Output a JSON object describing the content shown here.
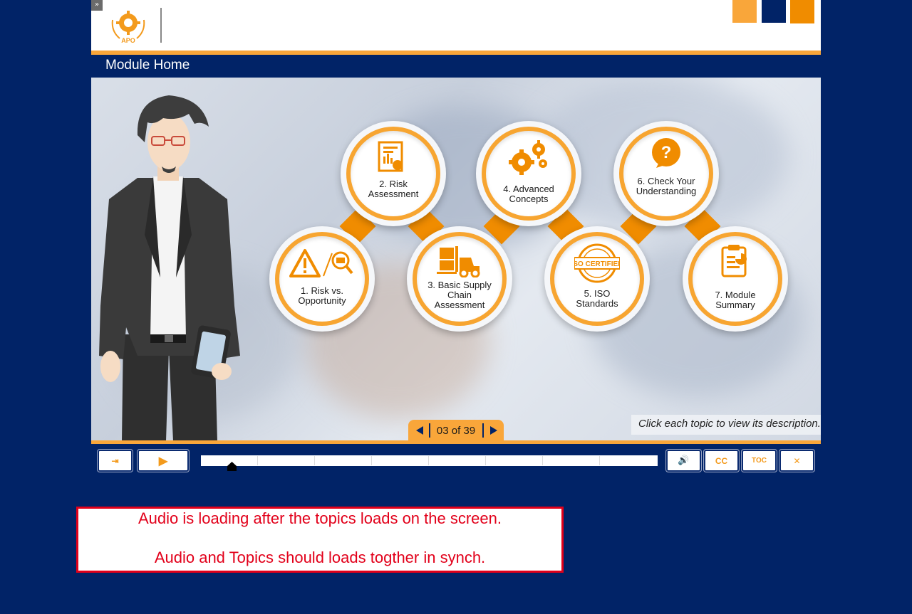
{
  "header": {
    "logo_text": "APO",
    "collapse_glyph": "»",
    "squares": [
      {
        "color": "#f9a63a"
      },
      {
        "color": "#012367"
      },
      {
        "color": "#f08c00"
      }
    ]
  },
  "page": {
    "title": "Module Home"
  },
  "topics": [
    {
      "label_line1": "1. Risk vs.",
      "label_line2": "Opportunity",
      "label_line3": "",
      "icon": "warning-magnifier-icon"
    },
    {
      "label_line1": "2. Risk",
      "label_line2": "Assessment",
      "label_line3": "",
      "icon": "report-document-icon"
    },
    {
      "label_line1": "3. Basic Supply",
      "label_line2": "Chain",
      "label_line3": "Assessment",
      "icon": "forklift-icon"
    },
    {
      "label_line1": "4. Advanced",
      "label_line2": "Concepts",
      "label_line3": "",
      "icon": "gears-icon"
    },
    {
      "label_line1": "5. ISO",
      "label_line2": "Standards",
      "label_line3": "",
      "icon": "iso-certified-stamp-icon",
      "stamp_text": "ISO CERTIFIED"
    },
    {
      "label_line1": "6. Check Your",
      "label_line2": "Understanding",
      "label_line3": "",
      "icon": "question-bubble-icon"
    },
    {
      "label_line1": "7. Module",
      "label_line2": "Summary",
      "label_line3": "",
      "icon": "clipboard-chart-icon"
    }
  ],
  "navigation": {
    "counter": "03 of 39",
    "hint": "Click each topic to view its description."
  },
  "controls": {
    "exit_glyph": "⇥",
    "play_glyph": "▶",
    "volume_glyph": "🔊",
    "cc_label": "CC",
    "toc_label": "TOC",
    "fullscreen_glyph": "✕",
    "progress_fraction": 0.07
  },
  "note": {
    "line1": "Audio is loading after the topics loads on the screen.",
    "line2": "Audio and Topics should loads togther in synch."
  },
  "colors": {
    "navy": "#012367",
    "orange": "#f9a63a",
    "dark_orange": "#f08c00",
    "note_red": "#e2001a"
  }
}
